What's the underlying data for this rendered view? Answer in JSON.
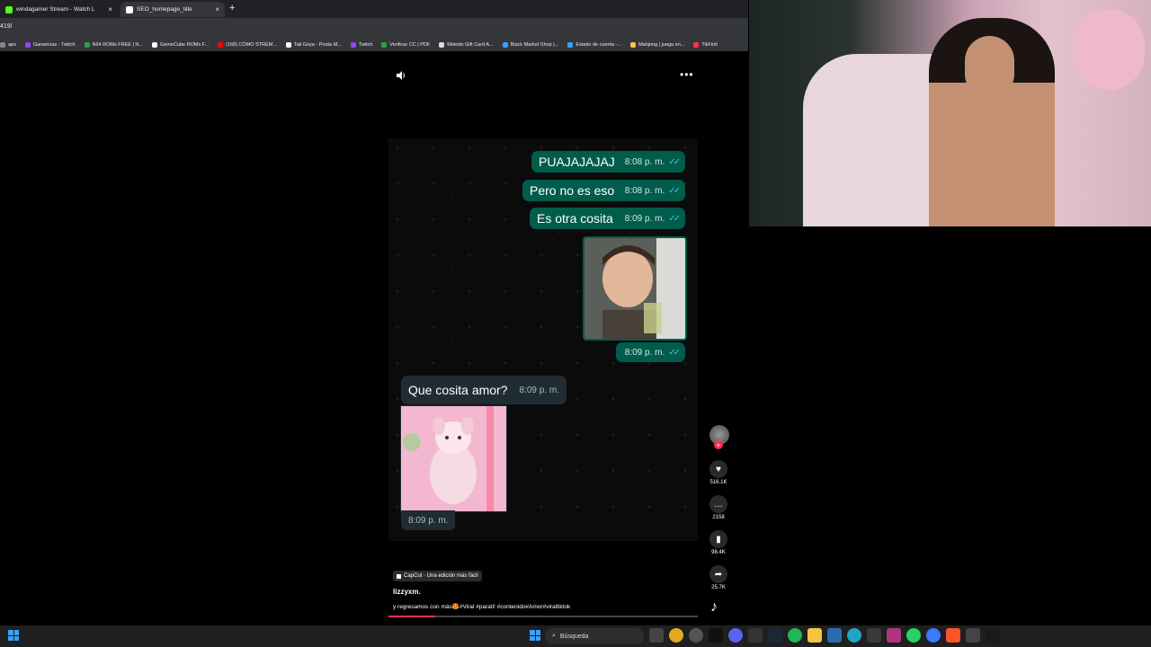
{
  "browser": {
    "tabs": [
      {
        "label": "windagamer Stream - Watch L",
        "fav_color": "#53fc18"
      },
      {
        "label": "SEO_homepage_title",
        "fav_color": "#ffffff"
      }
    ],
    "close_label": "×",
    "new_tab_label": "+",
    "url": "419/",
    "bookmarks": [
      {
        "label": "aps",
        "color": "#888888"
      },
      {
        "label": "Ganancias - Twitch",
        "color": "#9146ff"
      },
      {
        "label": "N64 ROMs FREE | N...",
        "color": "#2ea043"
      },
      {
        "label": "GameCube ROMs F...",
        "color": "#ffffff"
      },
      {
        "label": "(168) CÓMO STREM...",
        "color": "#ff0000"
      },
      {
        "label": "Tali Goya - Pirata M...",
        "color": "#ffffff"
      },
      {
        "label": "Twitch",
        "color": "#9146ff"
      },
      {
        "label": "Verificar CC | PDF",
        "color": "#2ea043"
      },
      {
        "label": "Metodo Gift Card A...",
        "color": "#dddddd"
      },
      {
        "label": "Black Market Shop |...",
        "color": "#3aa0ff"
      },
      {
        "label": "Estado de cuenta -...",
        "color": "#3aa0ff"
      },
      {
        "label": "Mahjong | juega en...",
        "color": "#f6c544"
      },
      {
        "label": "TikFinit",
        "color": "#ff3355"
      }
    ]
  },
  "chat": {
    "outgoing": [
      {
        "text": "PUAJAJAJAJ",
        "time": "8:08 p. m."
      },
      {
        "text": "Pero no es eso",
        "time": "8:08 p. m."
      },
      {
        "text": "Es otra cosita",
        "time": "8:09 p. m."
      }
    ],
    "photo_time": "8:09 p. m.",
    "ticks": "✓✓",
    "incoming_text": "Que cosita amor?",
    "incoming_time": "8:09 p. m.",
    "sticker_time": "8:09 p. m."
  },
  "tiktok": {
    "likes": "516.1K",
    "comments": "2158",
    "saves": "98.4K",
    "shares": "25.7K",
    "follow_plus": "+",
    "capcut_label": "CapCut · Una edición más fácil",
    "author": "lizzyxm.",
    "caption": "y regresamos con más😍#Viral #parati! #contenido#Amor#viraltiktok",
    "progress": 0.15
  },
  "taskbar": {
    "search_placeholder": "Búsqueda"
  },
  "colors": {
    "outgoing_bubble": "#005c4b",
    "incoming_bubble": "#202c33",
    "tiktok_accent": "#fe2c55",
    "read_ticks": "#53bdeb"
  }
}
